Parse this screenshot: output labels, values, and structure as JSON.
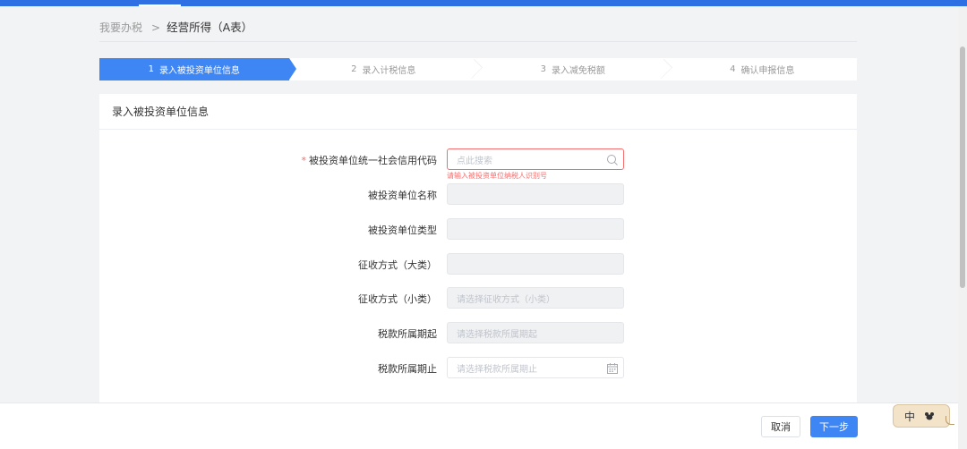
{
  "breadcrumb": {
    "root": "我要办税",
    "separator": ">",
    "current": "经营所得（A表）"
  },
  "steps": [
    {
      "num": "1",
      "label": "录入被投资单位信息",
      "active": true
    },
    {
      "num": "2",
      "label": "录入计税信息",
      "active": false
    },
    {
      "num": "3",
      "label": "录入减免税额",
      "active": false
    },
    {
      "num": "4",
      "label": "确认申报信息",
      "active": false
    }
  ],
  "card": {
    "title": "录入被投资单位信息"
  },
  "form": {
    "credit_code": {
      "required_mark": "*",
      "label": "被投资单位统一社会信用代码",
      "placeholder": "点此搜索",
      "error": "请输入被投资单位纳税人识别号"
    },
    "unit_name": {
      "label": "被投资单位名称",
      "value": ""
    },
    "unit_type": {
      "label": "被投资单位类型",
      "value": ""
    },
    "collect_major": {
      "label": "征收方式（大类）",
      "value": ""
    },
    "collect_minor": {
      "label": "征收方式（小类）",
      "placeholder": "请选择征收方式（小类）"
    },
    "period_start": {
      "label": "税款所属期起",
      "placeholder": "请选择税款所属期起"
    },
    "period_end": {
      "label": "税款所属期止",
      "placeholder": "请选择税款所属期止"
    }
  },
  "footer": {
    "cancel_label": "取消",
    "next_label": "下一步"
  },
  "ime": {
    "mode": "中"
  },
  "colors": {
    "accent": "#3f86f5",
    "header": "#2f6fe4",
    "error": "#f56c6c"
  }
}
